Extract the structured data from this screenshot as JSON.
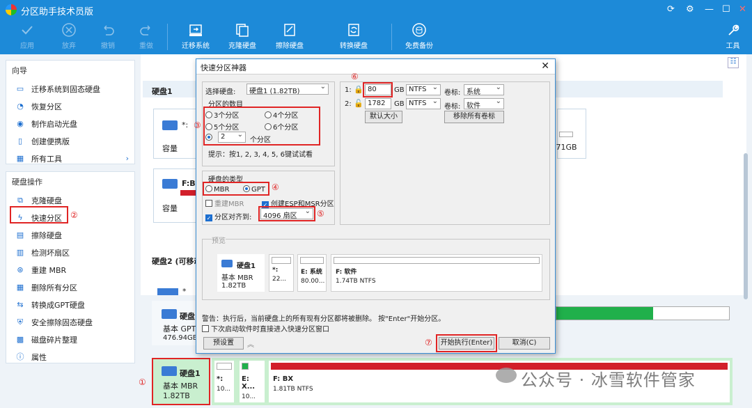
{
  "app": {
    "title": "分区助手技术员版"
  },
  "toolbar": {
    "apply": "应用",
    "discard": "放弃",
    "undo": "撤销",
    "redo": "重做",
    "migrate": "迁移系统",
    "clone": "克隆硬盘",
    "wipe": "擦除硬盘",
    "convert": "转换硬盘",
    "backup": "免费备份",
    "tools": "工具"
  },
  "guide": {
    "title": "向导",
    "items": [
      {
        "label": "迁移系统到固态硬盘"
      },
      {
        "label": "恢复分区"
      },
      {
        "label": "制作启动光盘"
      },
      {
        "label": "创建便携版"
      },
      {
        "label": "所有工具"
      }
    ]
  },
  "diskops": {
    "title": "硬盘操作",
    "items": [
      {
        "label": "克隆硬盘"
      },
      {
        "label": "快速分区"
      },
      {
        "label": "擦除硬盘"
      },
      {
        "label": "检测坏扇区"
      },
      {
        "label": "重建 MBR"
      },
      {
        "label": "删除所有分区"
      },
      {
        "label": "转换成GPT硬盘"
      },
      {
        "label": "安全擦除固态硬盘"
      },
      {
        "label": "磁盘碎片整理"
      },
      {
        "label": "属性"
      }
    ]
  },
  "main": {
    "disk1_header": "硬盘1",
    "disk2_header": "硬盘2 (可移动",
    "star_label": "*:",
    "fbx_label": "F:BX",
    "capacity_label": "容量",
    "size_71": ".71GB",
    "star2": "*",
    "bottom_top": {
      "name": "硬盘1",
      "type": "基本 GPT",
      "size": "476.94GB"
    },
    "bottom_sel": {
      "name": "硬盘1",
      "type": "基本 MBR",
      "size": "1.82TB",
      "p1_name": "*:",
      "p1_size": "10...",
      "p2_name": "E: X...",
      "p2_size": "10...",
      "p3_name": "F: BX",
      "p3_size": "1.81TB NTFS"
    }
  },
  "dialog": {
    "title": "快速分区神器",
    "select_disk_label": "选择硬盘:",
    "select_disk_value": "硬盘1 (1.82TB)",
    "count_label": "分区的数目",
    "opt3": "3个分区",
    "opt4": "4个分区",
    "opt5": "5个分区",
    "opt6": "6个分区",
    "custom_value": "2",
    "custom_unit": "个分区",
    "hint": "提示：按1, 2, 3, 4, 5, 6键试试看",
    "disktype_label": "硬盘的类型",
    "mbr": "MBR",
    "gpt": "GPT",
    "rebuild_mbr": "重建MBR",
    "create_esp": "创建ESP和MSR分区",
    "align_label": "分区对齐到:",
    "align_value": "4096 扇区",
    "rows": [
      {
        "index": "1:",
        "size": "80",
        "unit": "GB",
        "fs": "NTFS",
        "label_text": "卷标:",
        "label_value": "系统"
      },
      {
        "index": "2:",
        "size": "1782",
        "unit": "GB",
        "fs": "NTFS",
        "label_text": "卷标:",
        "label_value": "软件"
      }
    ],
    "default_size": "默认大小",
    "remove_labels": "移除所有卷标",
    "preview_label": "预览",
    "preview": {
      "name": "硬盘1",
      "type": "基本 MBR",
      "size": "1.82TB",
      "p1_name": "*:",
      "p1_size": "22...",
      "p2_name": "E: 系统",
      "p2_size": "80.00...",
      "p3_name": "F: 软件",
      "p3_size": "1.74TB NTFS"
    },
    "warning": "警告：执行后，当前硬盘上的所有现有分区都将被删除。 按\"Enter\"开始分区。",
    "next_boot": "下次启动软件时直接进入快速分区窗口",
    "presets": "预设置",
    "start": "开始执行(Enter)",
    "cancel": "取消(C)"
  },
  "markers": {
    "m1": "①",
    "m2": "②",
    "m3": "③",
    "m4": "④",
    "m5": "⑤",
    "m6": "⑥",
    "m7": "⑦"
  },
  "watermark": "公众号 · 冰雪软件管家",
  "colors": {
    "accent": "#1d8ad8",
    "highlight": "#e02424",
    "partition_red": "#d21f2a",
    "partition_green": "#20b04b"
  }
}
